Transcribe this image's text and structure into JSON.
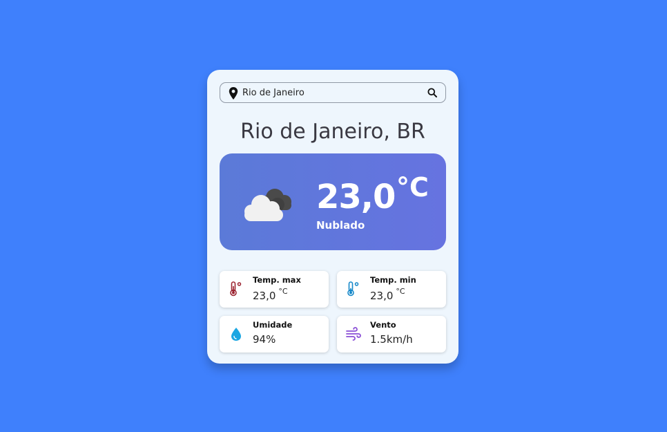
{
  "search": {
    "value": "Rio de Janeiro",
    "placeholder": "",
    "icon": "search-icon",
    "location_icon": "location-pin-icon"
  },
  "location": {
    "title": "Rio de Janeiro, BR"
  },
  "current": {
    "temperature": "23,0",
    "unit": "°C",
    "condition": "Nublado",
    "icon": "cloud-icon"
  },
  "stats": {
    "temp_max": {
      "label": "Temp. max",
      "value": "23,0",
      "unit": "°C",
      "icon": "thermometer-hot-icon"
    },
    "temp_min": {
      "label": "Temp. min",
      "value": "23,0",
      "unit": "°C",
      "icon": "thermometer-cold-icon"
    },
    "humidity": {
      "label": "Umidade",
      "value": "94%",
      "icon": "water-drop-icon"
    },
    "wind": {
      "label": "Vento",
      "value": "1.5km/h",
      "icon": "wind-icon"
    }
  },
  "colors": {
    "background": "#3f80fc",
    "card": "#eef6fd",
    "hero_gradient_start": "#5b7ad8",
    "hero_gradient_end": "#6673e0",
    "thermometer_hot": "#9b2330",
    "thermometer_cold": "#1688c9",
    "water_drop": "#1ba6e2",
    "wind": "#8a4fd6"
  }
}
